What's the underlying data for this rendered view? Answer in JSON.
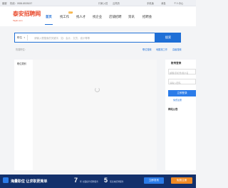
{
  "topbar": {
    "left_label": "客服",
    "phone": "热线：0538-8535157",
    "links": [
      "行家入驻",
      "云简历",
      "手机版",
      "消息",
      "个人中心"
    ]
  },
  "header": {
    "logo_text": "泰安招聘网",
    "logo_subtext": "Tajob.com",
    "nav": [
      "首页",
      "找工作",
      "找人才",
      "找企业",
      "店铺招聘",
      "资讯",
      "招聘会"
    ],
    "hot_badge": "HOT"
  },
  "search": {
    "category": "职位",
    "placeholder": "请输入想搜索的关键字，如：会计、文员、设计等等",
    "button": "搜索",
    "hot_label": "热搜职位：",
    "links": [
      "职位搜索",
      "地图找工作",
      "高级搜索"
    ]
  },
  "main": {
    "sidebar_label": "职位类别"
  },
  "login_panel": {
    "title": "账号登录",
    "username_placeholder": "邮箱/手机号/用户名",
    "password_placeholder": "请输入密码",
    "login_button": "立即登录",
    "register_link": "免费注册",
    "notice_title": "网站公告"
  },
  "footer": {
    "slogan": "海量职位 让求职更简单",
    "stat1_num": "7",
    "stat1_desc": "年 全面提升招聘服务",
    "stat2_num": "5",
    "stat2_desc": "项高效招聘服务",
    "btn_publish": "立即发布",
    "btn_register": "免费注册"
  }
}
